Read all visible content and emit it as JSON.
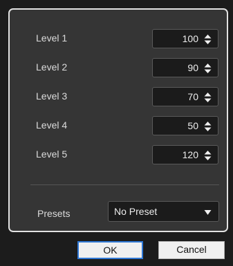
{
  "levels": [
    {
      "label": "Level 1",
      "value": "100"
    },
    {
      "label": "Level 2",
      "value": "90"
    },
    {
      "label": "Level 3",
      "value": "70"
    },
    {
      "label": "Level 4",
      "value": "50"
    },
    {
      "label": "Level 5",
      "value": "120"
    }
  ],
  "presets": {
    "label": "Presets",
    "value": "No Preset"
  },
  "buttons": {
    "ok": "OK",
    "cancel": "Cancel"
  },
  "icons": {
    "stepper": "up-down-arrows-icon",
    "dropdown": "triangle-down-icon"
  },
  "colors": {
    "panel": "#353535",
    "field": "#1b1b1b",
    "focus": "#2f78d6"
  }
}
